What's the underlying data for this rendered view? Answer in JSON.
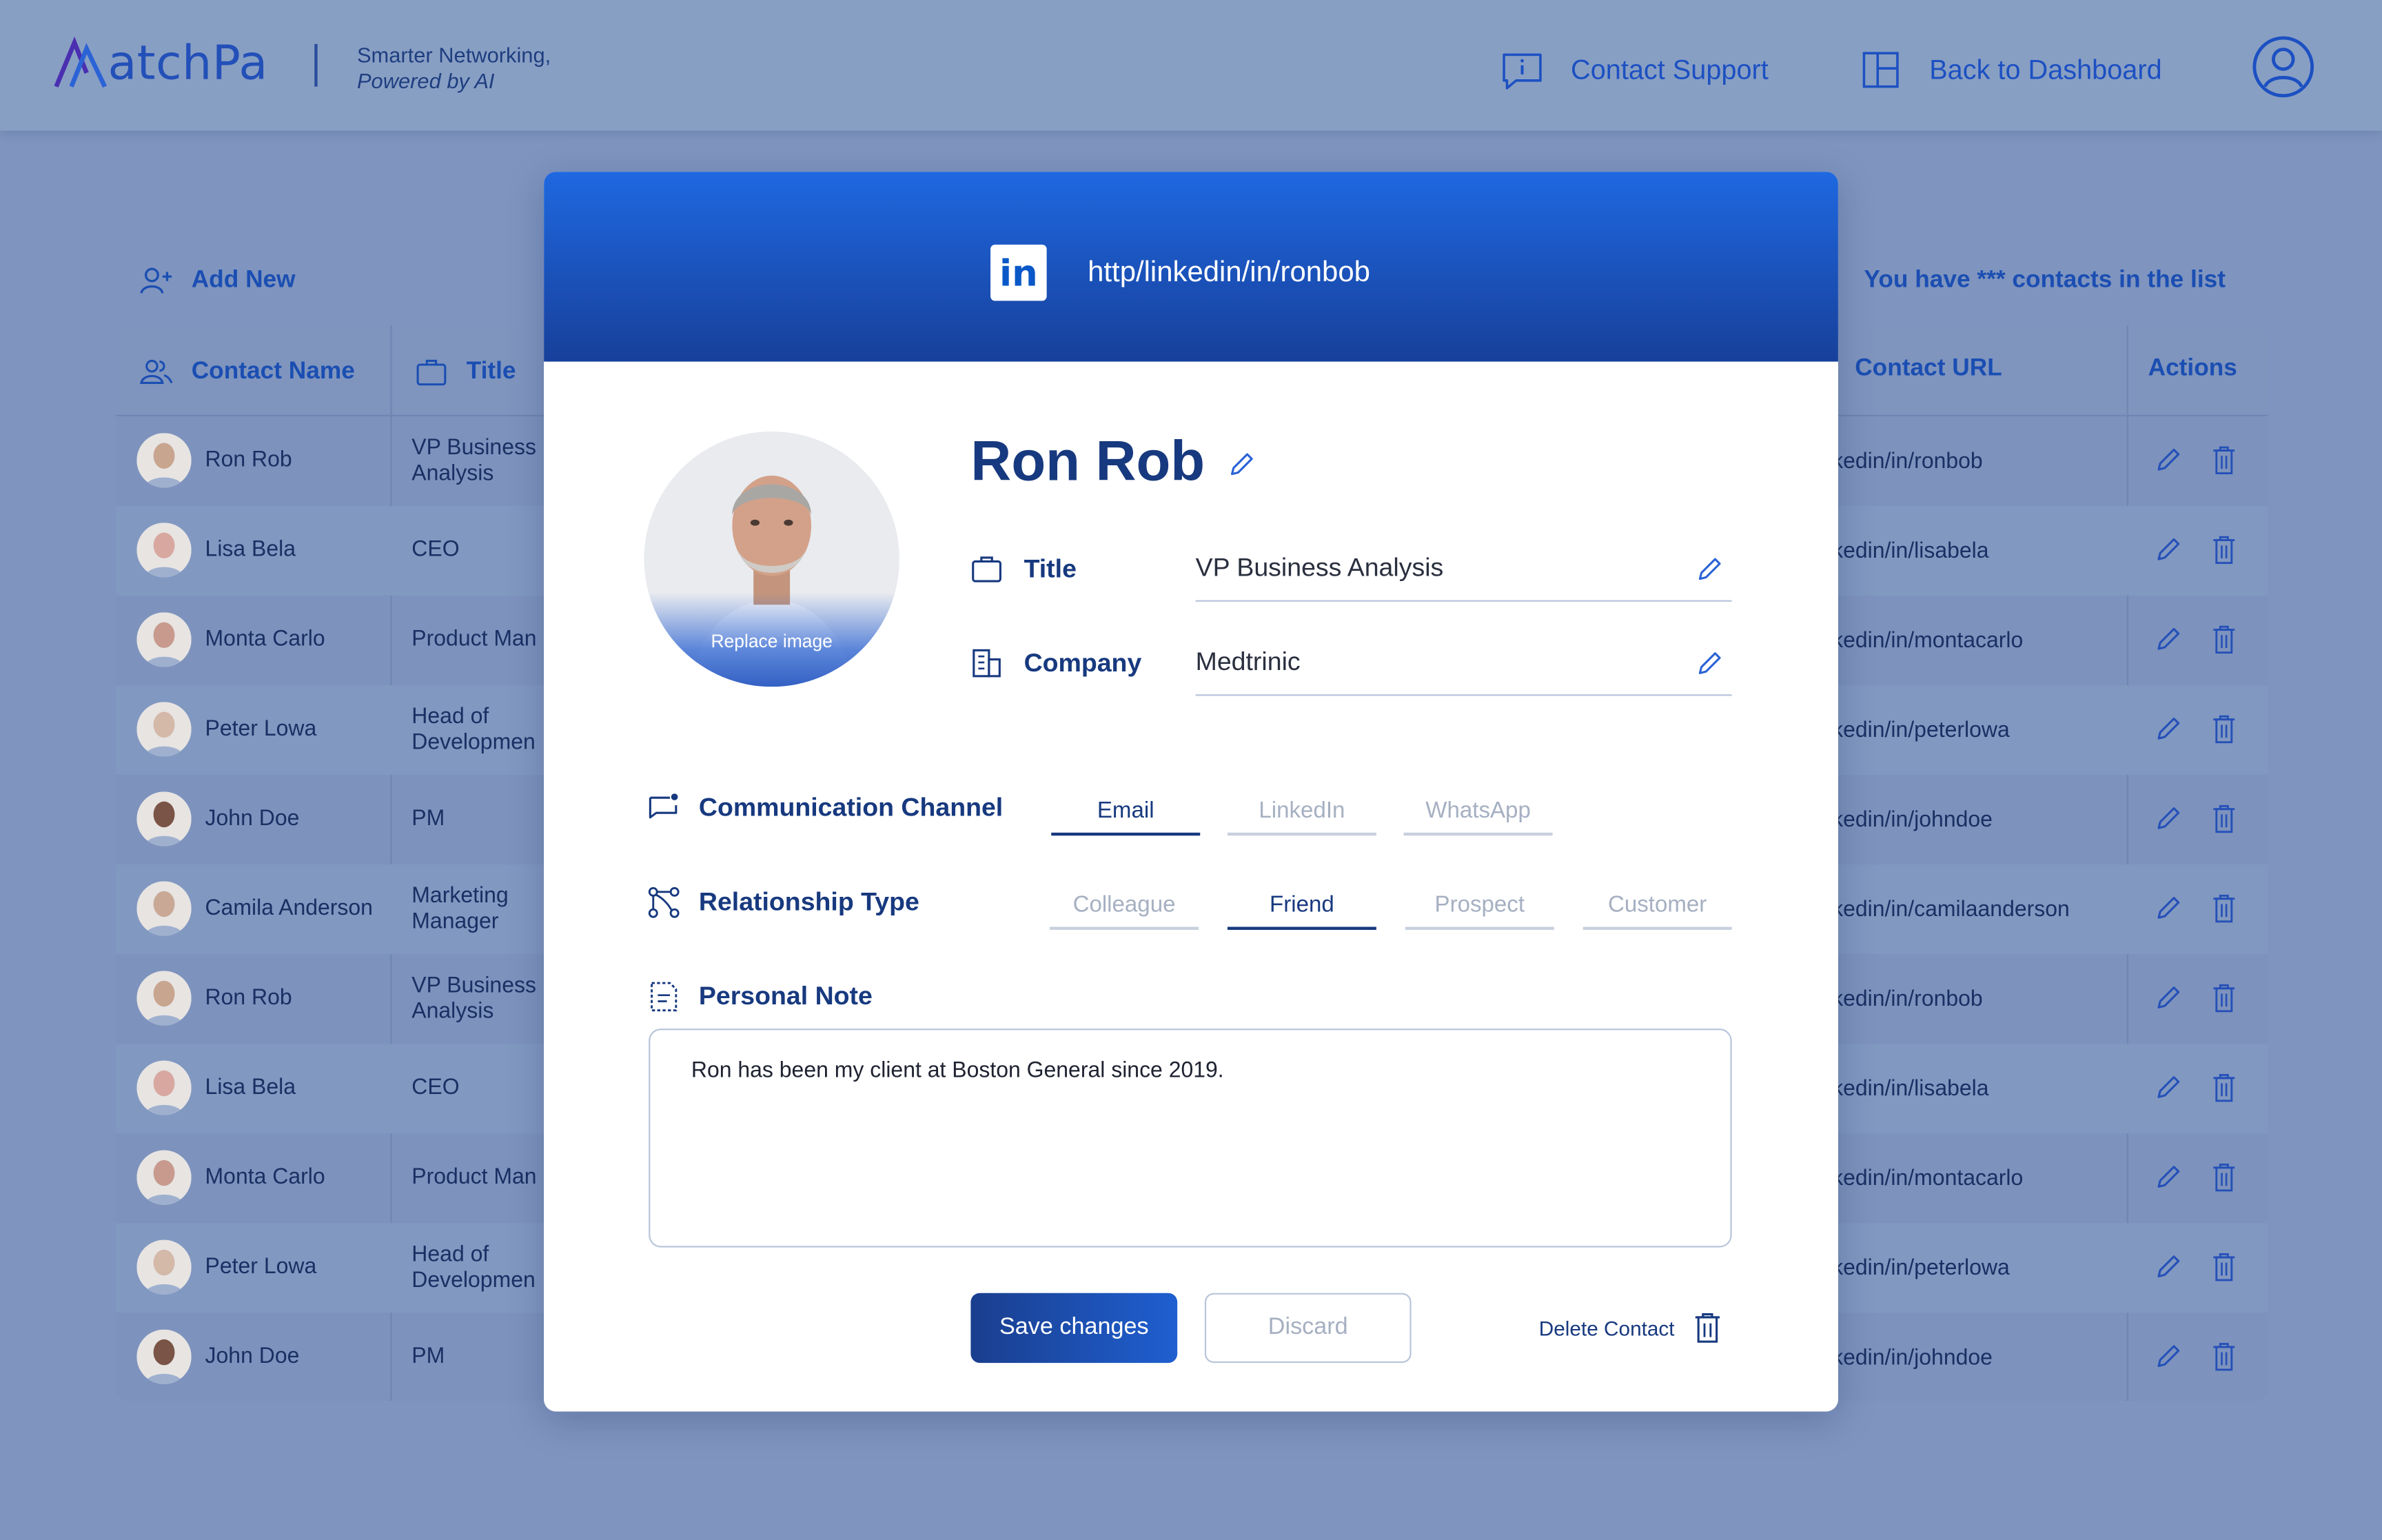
{
  "header": {
    "logo_text": "atchPa",
    "tagline_line1": "Smarter Networking,",
    "tagline_line2": "Powered by AI",
    "contact_support": "Contact Support",
    "back_to_dashboard": "Back to Dashboard"
  },
  "list": {
    "add_new": "Add New",
    "count_text": "You have *** contacts in the list",
    "columns": {
      "name": "Contact Name",
      "title": "Title",
      "url": "Contact URL",
      "actions": "Actions"
    },
    "rows": [
      {
        "name": "Ron Rob",
        "title": "VP Business Analysis",
        "url": "kedin/in/ronbob"
      },
      {
        "name": "Lisa Bela",
        "title": "CEO",
        "url": "kedin/in/lisabela"
      },
      {
        "name": "Monta Carlo",
        "title": "Product Man",
        "url": "kedin/in/montacarlo"
      },
      {
        "name": "Peter Lowa",
        "title": "Head of Developmen",
        "url": "kedin/in/peterlowa"
      },
      {
        "name": "John Doe",
        "title": "PM",
        "url": "kedin/in/johndoe"
      },
      {
        "name": "Camila Anderson",
        "title": "Marketing Manager",
        "url": "kedin/in/camilaanderson"
      },
      {
        "name": "Ron Rob",
        "title": "VP Business Analysis",
        "url": "kedin/in/ronbob"
      },
      {
        "name": "Lisa Bela",
        "title": "CEO",
        "url": "kedin/in/lisabela"
      },
      {
        "name": "Monta Carlo",
        "title": "Product Man",
        "url": "kedin/in/montacarlo"
      },
      {
        "name": "Peter Lowa",
        "title": "Head of Developmen",
        "url": "kedin/in/peterlowa"
      },
      {
        "name": "John Doe",
        "title": "PM",
        "url": "kedin/in/johndoe"
      }
    ]
  },
  "modal": {
    "linkedin_logo": "in",
    "linkedin_url": "http/linkedin/in/ronbob",
    "replace_image": "Replace image",
    "contact_name": "Ron Rob",
    "title_label": "Title",
    "title_value": "VP Business Analysis",
    "company_label": "Company",
    "company_value": "Medtrinic",
    "channel_label": "Communication Channel",
    "channels": [
      "Email",
      "LinkedIn",
      "WhatsApp"
    ],
    "channel_selected": "Email",
    "relationship_label": "Relationship Type",
    "relationships": [
      "Colleague",
      "Friend",
      "Prospect",
      "Customer"
    ],
    "relationship_selected": "Friend",
    "note_label": "Personal Note",
    "note_text": "Ron has been my client at Boston General since 2019.",
    "save_label": "Save changes",
    "discard_label": "Discard",
    "delete_label": "Delete Contact"
  },
  "colors": {
    "overlay_bg": "#7f95bf",
    "brand_blue": "#1f5fd0",
    "dark_navy": "#17397f"
  }
}
